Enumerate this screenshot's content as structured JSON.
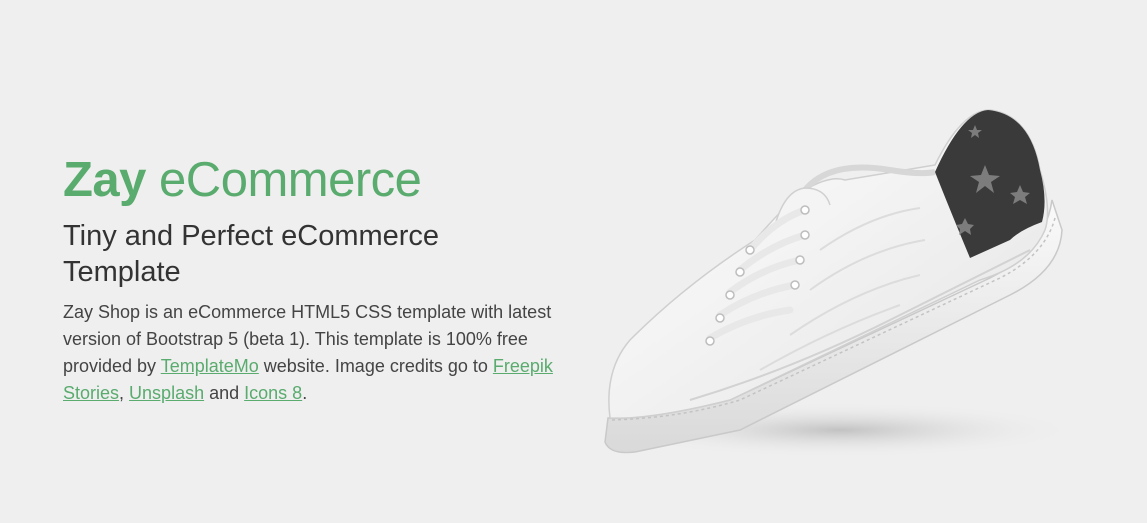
{
  "hero": {
    "title_brand": "Zay",
    "title_rest": " eCommerce",
    "subtitle": "Tiny and Perfect eCommerce Template",
    "description": {
      "part1": "Zay Shop is an eCommerce HTML5 CSS template with latest version of Bootstrap 5 (beta 1). This template is 100% free provided by ",
      "link_templatemo": "TemplateMo",
      "part2": " website. Image credits go to ",
      "link_freepik": "Freepik Stories",
      "sep1": ", ",
      "link_unsplash": "Unsplash",
      "sep2": " and ",
      "link_icons8": "Icons 8",
      "end": "."
    },
    "image": "white-sneaker-image"
  },
  "colors": {
    "accent": "#59ab6e",
    "background": "#efefef",
    "text": "#333333"
  }
}
